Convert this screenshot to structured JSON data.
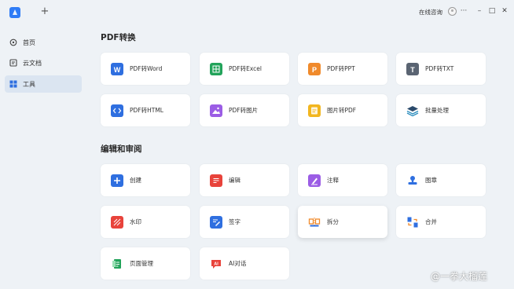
{
  "titlebar": {
    "new_tab_symbol": "+",
    "consult_label": "在线咨询",
    "more_symbol": "···",
    "minimize_symbol": "–",
    "maximize_symbol": "□",
    "close_symbol": "✕"
  },
  "sidebar": {
    "items": [
      {
        "label": "首页",
        "icon": "home-icon"
      },
      {
        "label": "云文档",
        "icon": "cloud-doc-icon"
      },
      {
        "label": "工具",
        "icon": "tools-grid-icon",
        "active": true
      }
    ]
  },
  "sections": {
    "convert": {
      "title": "PDF转换",
      "cards": [
        {
          "label": "PDF转Word",
          "icon": "word-icon",
          "color": "#2f6fe0"
        },
        {
          "label": "PDF转Excel",
          "icon": "excel-icon",
          "color": "#22a35a"
        },
        {
          "label": "PDF转PPT",
          "icon": "ppt-icon",
          "color": "#f08a2b"
        },
        {
          "label": "PDF转TXT",
          "icon": "txt-icon",
          "color": "#5a6472"
        },
        {
          "label": "PDF转HTML",
          "icon": "html-icon",
          "color": "#2f6fe0"
        },
        {
          "label": "PDF转图片",
          "icon": "image-icon",
          "color": "#9b5de5"
        },
        {
          "label": "图片转PDF",
          "icon": "image-to-pdf-icon",
          "color": "#f2b61f"
        },
        {
          "label": "批量处理",
          "icon": "layers-icon",
          "color": "#2b4a6b"
        }
      ]
    },
    "edit": {
      "title": "编辑和审阅",
      "cards": [
        {
          "label": "创建",
          "icon": "create-icon",
          "color": "#2f6fe0"
        },
        {
          "label": "编辑",
          "icon": "edit-icon",
          "color": "#e8433b"
        },
        {
          "label": "注释",
          "icon": "annotate-icon",
          "color": "#9b5de5"
        },
        {
          "label": "图章",
          "icon": "stamp-icon",
          "color": "#2f6fe0"
        },
        {
          "label": "水印",
          "icon": "watermark-icon",
          "color": "#e8433b"
        },
        {
          "label": "签字",
          "icon": "sign-icon",
          "color": "#2f6fe0"
        },
        {
          "label": "拆分",
          "icon": "split-icon",
          "color": "#f08a2b"
        },
        {
          "label": "合并",
          "icon": "merge-icon",
          "color": "#2f6fe0"
        },
        {
          "label": "页面管理",
          "icon": "page-manage-icon",
          "color": "#22a35a"
        },
        {
          "label": "AI对话",
          "icon": "ai-chat-icon",
          "color": "#e8433b"
        }
      ]
    }
  },
  "watermark": {
    "text": "@一拳大榴莲"
  },
  "colors": {
    "background": "#eef2f6",
    "accent": "#2f7cf6",
    "sidebar_active": "#dbe5f1"
  }
}
